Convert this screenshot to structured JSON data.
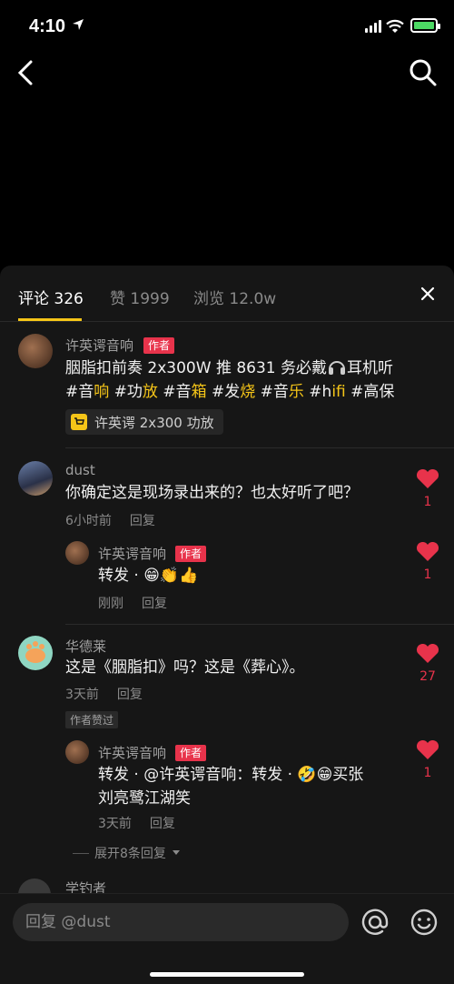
{
  "status": {
    "time": "4:10"
  },
  "tabs": {
    "comments": "评论 326",
    "likes": "赞 1999",
    "views": "浏览 12.0w"
  },
  "author_post": {
    "name": "许英谔音响",
    "badge": "作者",
    "line1": "胭脂扣前奏 2x300W 推 8631 务必戴",
    "line1_tail": "耳机听",
    "tags": [
      "#音",
      "响",
      " #功",
      "放",
      " #音",
      "箱",
      " #发",
      "烧",
      " #音",
      "乐",
      " #h",
      "ifi",
      " #高保"
    ],
    "product": "许英谔 2x300 功放"
  },
  "comments": [
    {
      "name": "dust",
      "text": "你确定这是现场录出来的？也太好听了吧？",
      "time": "6小时前",
      "reply": "回复",
      "likes": "1",
      "replies": [
        {
          "name": "许英谔音响",
          "badge": "作者",
          "text": "转发 · 😁👏👍",
          "time": "刚刚",
          "reply": "回复",
          "likes": "1"
        }
      ]
    },
    {
      "name": "华德莱",
      "text": "这是《胭脂扣》吗？这是《葬心》。",
      "time": "3天前",
      "reply": "回复",
      "likes": "27",
      "author_liked": "作者赞过",
      "replies": [
        {
          "name": "许英谔音响",
          "badge": "作者",
          "text1": "转发 · @许英谔音响：转发 · 🤣😁买张",
          "text2": "刘亮鹭江湖笑",
          "time": "3天前",
          "reply": "回复",
          "likes": "1"
        }
      ],
      "expand": "展开8条回复"
    }
  ],
  "peek": {
    "name": "学钓者"
  },
  "bottom": {
    "placeholder": "回复 @dust"
  },
  "colors": {
    "accent": "#f5c518",
    "like": "#e8334b",
    "bg": "#161616"
  }
}
